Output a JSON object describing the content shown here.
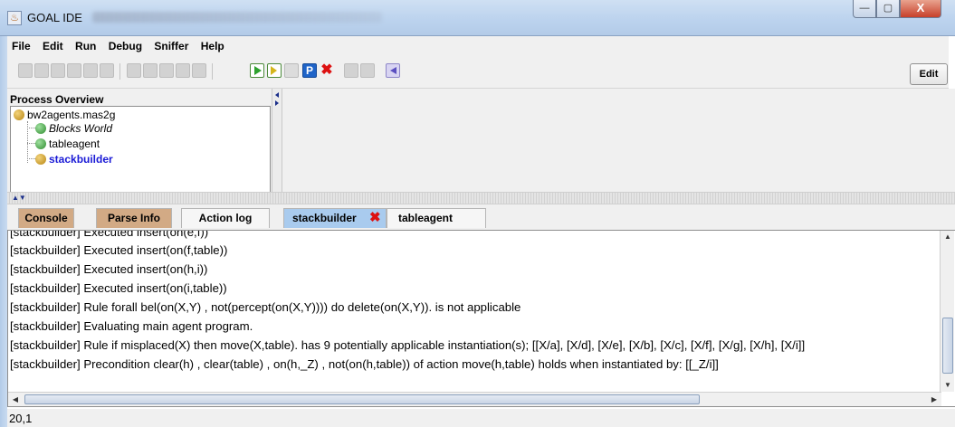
{
  "window": {
    "title": "GOAL IDE",
    "minimize": "—",
    "maximize": "▢",
    "close": "X"
  },
  "menu": [
    "File",
    "Edit",
    "Run",
    "Debug",
    "Sniffer",
    "Help"
  ],
  "toolbar": {
    "edit_label": "Edit",
    "pause_label": "P",
    "kill_label": "✖"
  },
  "process_overview": {
    "title": "Process Overview",
    "root": "bw2agents.mas2g",
    "children": [
      "Blocks World",
      "tableagent",
      "stackbuilder"
    ]
  },
  "tabs": [
    "Console",
    "Parse Info",
    "Action log",
    "stackbuilder",
    "tableagent"
  ],
  "console": {
    "lines": [
      "[stackbuilder] Executed insert(on(e,f))",
      "[stackbuilder] Executed insert(on(f,table))",
      "[stackbuilder] Executed insert(on(h,i))",
      "[stackbuilder] Executed insert(on(i,table))",
      "[stackbuilder] Rule forall bel(on(X,Y) , not(percept(on(X,Y)))) do delete(on(X,Y)). is not applicable",
      "[stackbuilder] Evaluating main agent program.",
      "[stackbuilder] Rule if misplaced(X) then move(X,table). has 9 potentially applicable instantiation(s); [[X/a], [X/d], [X/e], [X/b], [X/c], [X/f], [X/g], [X/h], [X/i]]",
      "[stackbuilder] Precondition clear(h) , clear(table) , on(h,_Z) , not(on(h,table)) of action move(h,table) holds when instantiated by: [[_Z/i]]"
    ]
  },
  "status": {
    "position": "20,1"
  },
  "colors": {
    "titlebar": "#bcd3ee",
    "tab_console": "#d2aa85",
    "tab_active": "#a9cbee",
    "link_blue": "#1a1ad6"
  }
}
